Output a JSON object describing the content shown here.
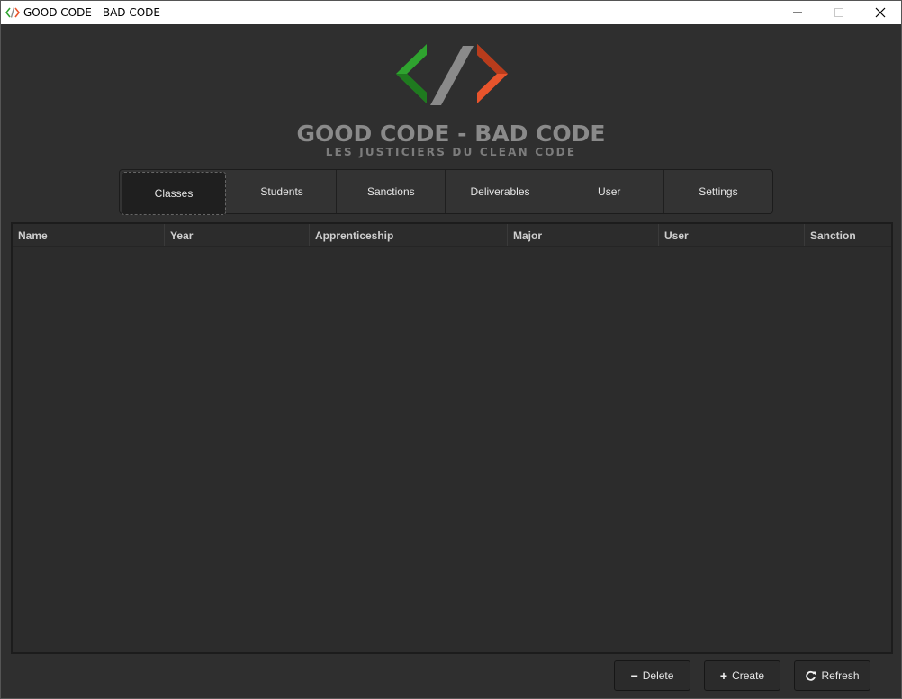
{
  "window": {
    "title": "GOOD CODE - BAD CODE",
    "controls": [
      "minimize",
      "maximize",
      "close"
    ]
  },
  "logo": {
    "title": "GOOD CODE - BAD CODE",
    "subtitle": "LES JUSTICIERS DU CLEAN CODE",
    "colors": {
      "left": "#2fa32f",
      "slash": "#8a8a8a",
      "right": "#e8542c"
    }
  },
  "tabs": [
    {
      "label": "Classes",
      "active": true
    },
    {
      "label": "Students",
      "active": false
    },
    {
      "label": "Sanctions",
      "active": false
    },
    {
      "label": "Deliverables",
      "active": false
    },
    {
      "label": "User",
      "active": false
    },
    {
      "label": "Settings",
      "active": false
    }
  ],
  "table": {
    "columns": [
      "Name",
      "Year",
      "Apprenticeship",
      "Major",
      "User",
      "Sanction"
    ],
    "rows": []
  },
  "actions": {
    "delete_label": "Delete",
    "create_label": "Create",
    "refresh_label": "Refresh"
  }
}
